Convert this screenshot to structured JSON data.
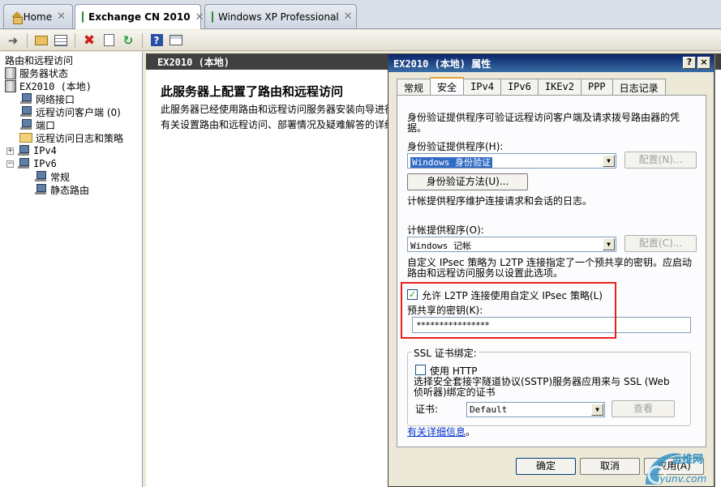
{
  "browser_tabs": [
    {
      "label": "Home",
      "icon": "home-icon"
    },
    {
      "label": "Exchange CN 2010",
      "icon": "vm-icon",
      "active": true
    },
    {
      "label": "Windows XP Professional",
      "icon": "vm-icon"
    }
  ],
  "close_glyph": "✕",
  "tree": {
    "root": "路由和远程访问",
    "items": [
      "服务器状态",
      "EX2010 (本地)",
      "网络接口",
      "远程访问客户端 (0)",
      "端口",
      "远程访问日志和策略",
      "IPv4",
      "IPv6",
      "常规",
      "静态路由"
    ],
    "plus": "+",
    "minus": "−"
  },
  "main": {
    "header": "EX2010 (本地)",
    "title": "此服务器上配置了路由和远程访问",
    "desc_line1": "此服务器已经使用路由和远程访问服务器安装向导进行",
    "desc_line2": "有关设置路由和远程访问、部署情况及疑难解答的详细"
  },
  "dialog": {
    "title": "EX2010 (本地) 属性",
    "help_btn": "?",
    "close_btn": "×",
    "tabs": [
      "常规",
      "安全",
      "IPv4",
      "IPv6",
      "IKEv2",
      "PPP",
      "日志记录"
    ],
    "auth_desc": "身份验证提供程序可验证远程访问客户端及请求拨号路由器的凭据。",
    "auth_provider_label": "身份验证提供程序(H):",
    "auth_provider_value": "Windows 身份验证",
    "config_n": "配置(N)...",
    "auth_methods_btn": "身份验证方法(U)...",
    "acct_desc": "计帐提供程序维护连接请求和会话的日志。",
    "acct_provider_label": "计帐提供程序(O):",
    "acct_provider_value": "Windows 记帐",
    "config_c": "配置(C)...",
    "ipsec_desc": "自定义 IPsec 策略为 L2TP 连接指定了一个预共享的密钥。应启动路由和远程访问服务以设置此选项。",
    "allow_l2tp_label": "允许 L2TP 连接使用自定义 IPsec 策略(L)",
    "allow_l2tp_checked": "✓",
    "psk_label": "预共享的密钥(K):",
    "psk_value": "****************",
    "ssl_group_label": "SSL 证书绑定:",
    "use_http_label": "使用 HTTP",
    "sstp_desc": "选择安全套接字隧道协议(SSTP)服务器应用来与 SSL (Web 侦听器)绑定的证书",
    "cert_label": "证书:",
    "cert_value": "Default",
    "view_btn": "查看",
    "more_info": "有关详细信息",
    "more_info_suffix": "。",
    "ok": "确定",
    "cancel": "取消",
    "apply": "应用(A)"
  },
  "watermark": {
    "text": "运维网",
    "url": "iyunv.com"
  },
  "colors": {
    "highlight_box": "#e8211c",
    "title_bar": "#0a246a",
    "selection": "#316ac5"
  }
}
